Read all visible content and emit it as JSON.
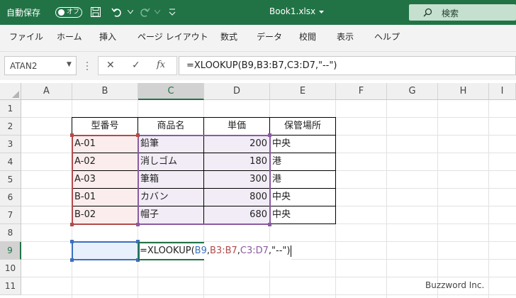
{
  "titlebar": {
    "autosave_label": "自動保存",
    "autosave_state": "オフ",
    "filename": "Book1.xlsx",
    "search_label": "検索"
  },
  "menu": [
    "ファイル",
    "ホーム",
    "挿入",
    "ページ レイアウト",
    "数式",
    "データ",
    "校閲",
    "表示",
    "ヘルプ"
  ],
  "formula_bar": {
    "name_box": "ATAN2",
    "formula": "=XLOOKUP(B9,B3:B7,C3:D7,\"--\")"
  },
  "columns": [
    "A",
    "B",
    "C",
    "D",
    "E",
    "F",
    "G",
    "H",
    "I"
  ],
  "rows": [
    "1",
    "2",
    "3",
    "4",
    "5",
    "6",
    "7",
    "8",
    "9",
    "10",
    "11"
  ],
  "table": {
    "headers": [
      "型番号",
      "商品名",
      "単価",
      "保管場所"
    ],
    "rows": [
      [
        "A-01",
        "鉛筆",
        "200",
        "中央"
      ],
      [
        "A-02",
        "消しゴム",
        "180",
        "港"
      ],
      [
        "A-03",
        "筆箱",
        "300",
        "港"
      ],
      [
        "B-01",
        "カバン",
        "800",
        "中央"
      ],
      [
        "B-02",
        "帽子",
        "680",
        "中央"
      ]
    ]
  },
  "edit_cell": {
    "prefix": "=XLOOKUP(",
    "ref1": "B9",
    "sep1": ",",
    "ref2": "B3:B7",
    "sep2": ",",
    "ref3": "C3:D7",
    "suffix": ",\"--\")"
  },
  "watermark": "Buzzword Inc.",
  "colors": {
    "accent": "#217346",
    "ref_blue": "#3c6fbf",
    "ref_red": "#b24a4a",
    "ref_purple": "#8a5aa0"
  }
}
